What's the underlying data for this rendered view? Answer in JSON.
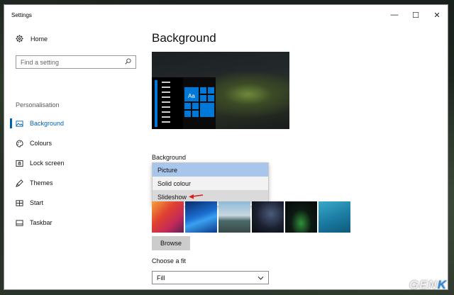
{
  "window": {
    "title": "Settings",
    "controls": {
      "minimize": "—",
      "maximize": "☐",
      "close": "✕"
    }
  },
  "sidebar": {
    "home_label": "Home",
    "search_placeholder": "Find a setting",
    "section_label": "Personalisation",
    "items": [
      {
        "label": "Background",
        "icon": "picture-icon",
        "active": true
      },
      {
        "label": "Colours",
        "icon": "palette-icon",
        "active": false
      },
      {
        "label": "Lock screen",
        "icon": "lock-screen-icon",
        "active": false
      },
      {
        "label": "Themes",
        "icon": "themes-icon",
        "active": false
      },
      {
        "label": "Start",
        "icon": "start-icon",
        "active": false
      },
      {
        "label": "Taskbar",
        "icon": "taskbar-icon",
        "active": false
      }
    ]
  },
  "main": {
    "title": "Background",
    "preview_tile_text": "Aa",
    "background_label": "Background",
    "background_options": [
      {
        "label": "Picture",
        "state": "selected"
      },
      {
        "label": "Solid colour",
        "state": "normal"
      },
      {
        "label": "Slideshow",
        "state": "hover"
      }
    ],
    "browse_label": "Browse",
    "fit_label": "Choose a fit",
    "fit_value": "Fill"
  },
  "watermark": {
    "text": "GEN",
    "accent": "K"
  },
  "colors": {
    "accent": "#0063b1",
    "tile_blue": "#0078d7",
    "annotation_red": "#e01a1a"
  }
}
